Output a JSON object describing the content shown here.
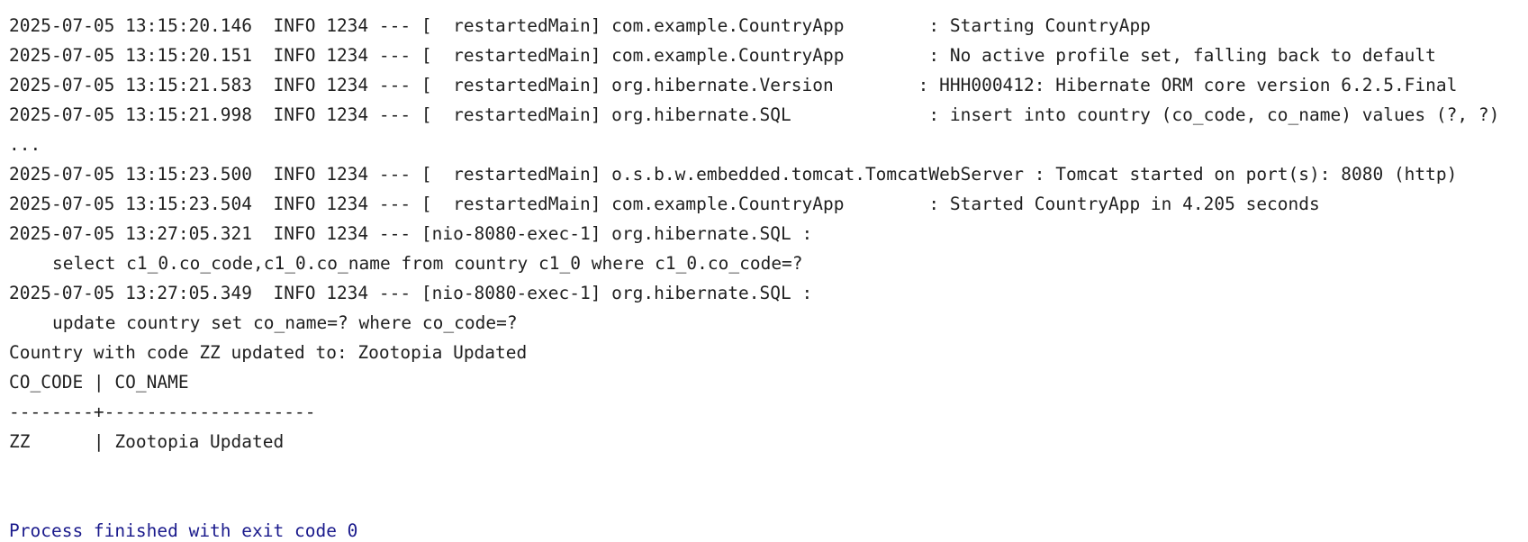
{
  "console": {
    "log_lines": [
      "2025-07-05 13:15:20.146  INFO 1234 --- [  restartedMain] com.example.CountryApp        : Starting CountryApp",
      "2025-07-05 13:15:20.151  INFO 1234 --- [  restartedMain] com.example.CountryApp        : No active profile set, falling back to default",
      "2025-07-05 13:15:21.583  INFO 1234 --- [  restartedMain] org.hibernate.Version        : HHH000412: Hibernate ORM core version 6.2.5.Final",
      "2025-07-05 13:15:21.998  INFO 1234 --- [  restartedMain] org.hibernate.SQL             : insert into country (co_code, co_name) values (?, ?)",
      "...",
      "2025-07-05 13:15:23.500  INFO 1234 --- [  restartedMain] o.s.b.w.embedded.tomcat.TomcatWebServer : Tomcat started on port(s): 8080 (http)",
      "2025-07-05 13:15:23.504  INFO 1234 --- [  restartedMain] com.example.CountryApp        : Started CountryApp in 4.205 seconds",
      "2025-07-05 13:27:05.321  INFO 1234 --- [nio-8080-exec-1] org.hibernate.SQL :",
      "select c1_0.co_code,c1_0.co_name from country c1_0 where c1_0.co_code=?",
      "2025-07-05 13:27:05.349  INFO 1234 --- [nio-8080-exec-1] org.hibernate.SQL :",
      "update country set co_name=? where co_code=?",
      "Country with code ZZ updated to: Zootopia Updated",
      "CO_CODE | CO_NAME",
      "--------+--------------------",
      "ZZ      | Zootopia Updated"
    ],
    "process_message": "Process finished with exit code 0"
  }
}
